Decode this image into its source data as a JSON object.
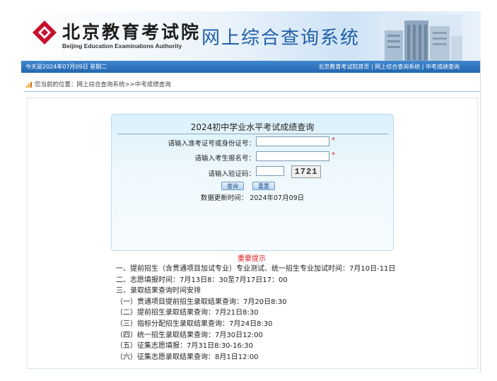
{
  "header": {
    "logo_cn": "北京教育考试院",
    "logo_en": "Beijing Education Examinations Authority",
    "system_title": "网上综合查询系统"
  },
  "navbar": {
    "date": "今天是2024年07月09日 星期二",
    "links": [
      "北京教育考试院首页",
      "网上综合查询系统",
      "中考成绩查询"
    ],
    "separator": "|"
  },
  "breadcrumb": {
    "prefix": "您当前的位置：",
    "path": "网上综合查询系统>>中考成绩查询"
  },
  "query_form": {
    "title": "2024初中学业水平考试成绩查询",
    "fields": [
      {
        "label": "请输入准考证号或身份证号：",
        "value": "",
        "required": true
      },
      {
        "label": "请输入考生报名号：",
        "value": "",
        "required": true
      },
      {
        "label": "请输入验证码：",
        "value": "",
        "required": false
      }
    ],
    "required_mark": "*",
    "captcha_text": "1721",
    "submit_label": "查询",
    "reset_label": "重置",
    "update_text": "数据更新时间：  2024年07月09日"
  },
  "notice": {
    "title": "重要提示",
    "items": [
      "一、提前招生（含贯通项目加试专业）专业测试、统一招生专业加试时间：7月10日-11日",
      "二、志愿填报时间：7月13日8：30至7月17日17：00",
      "三、录取结果查询时间安排",
      "（一）贯通项目提前招生录取结果查询：7月20日8:30",
      "（二）提前招生录取结果查询：7月21日8:30",
      "（三）指标分配招生录取结果查询：7月24日8:30",
      "（四）统一招生录取结果查询：7月30日12:00",
      "（五）征集志愿填报：7月31日8:30-16:30",
      "（六）征集志愿录取结果查询：8月1日12:00"
    ]
  },
  "colors": {
    "nav_blue": "#2366b0",
    "title_blue": "#1f5fa8",
    "logo_red": "#c8102e",
    "required_red": "#e02020"
  }
}
